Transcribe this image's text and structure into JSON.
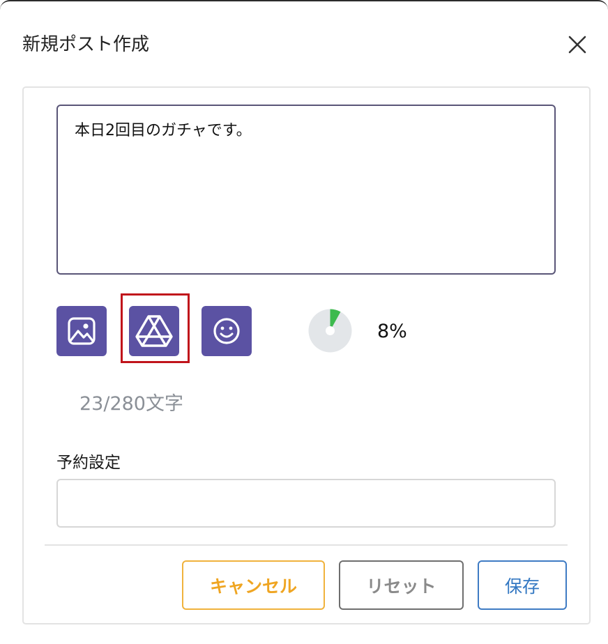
{
  "dialog": {
    "title": "新規ポスト作成"
  },
  "post": {
    "text": "本日2回目のガチャです。"
  },
  "toolbar": {
    "image_icon": "image-icon",
    "drive_icon": "google-drive-icon",
    "emoji_icon": "emoji-icon"
  },
  "progress": {
    "fraction": 0.08,
    "label": "8%"
  },
  "counter": {
    "text": "23/280文字"
  },
  "schedule": {
    "label": "予約設定",
    "value": ""
  },
  "actions": {
    "cancel_label": "キャンセル",
    "reset_label": "リセット",
    "save_label": "保存"
  },
  "colors": {
    "accent": "#5b52a3",
    "highlight": "#c0141b",
    "progress": "#3dba4e",
    "cancel": "#efa522",
    "save": "#3277c2"
  }
}
